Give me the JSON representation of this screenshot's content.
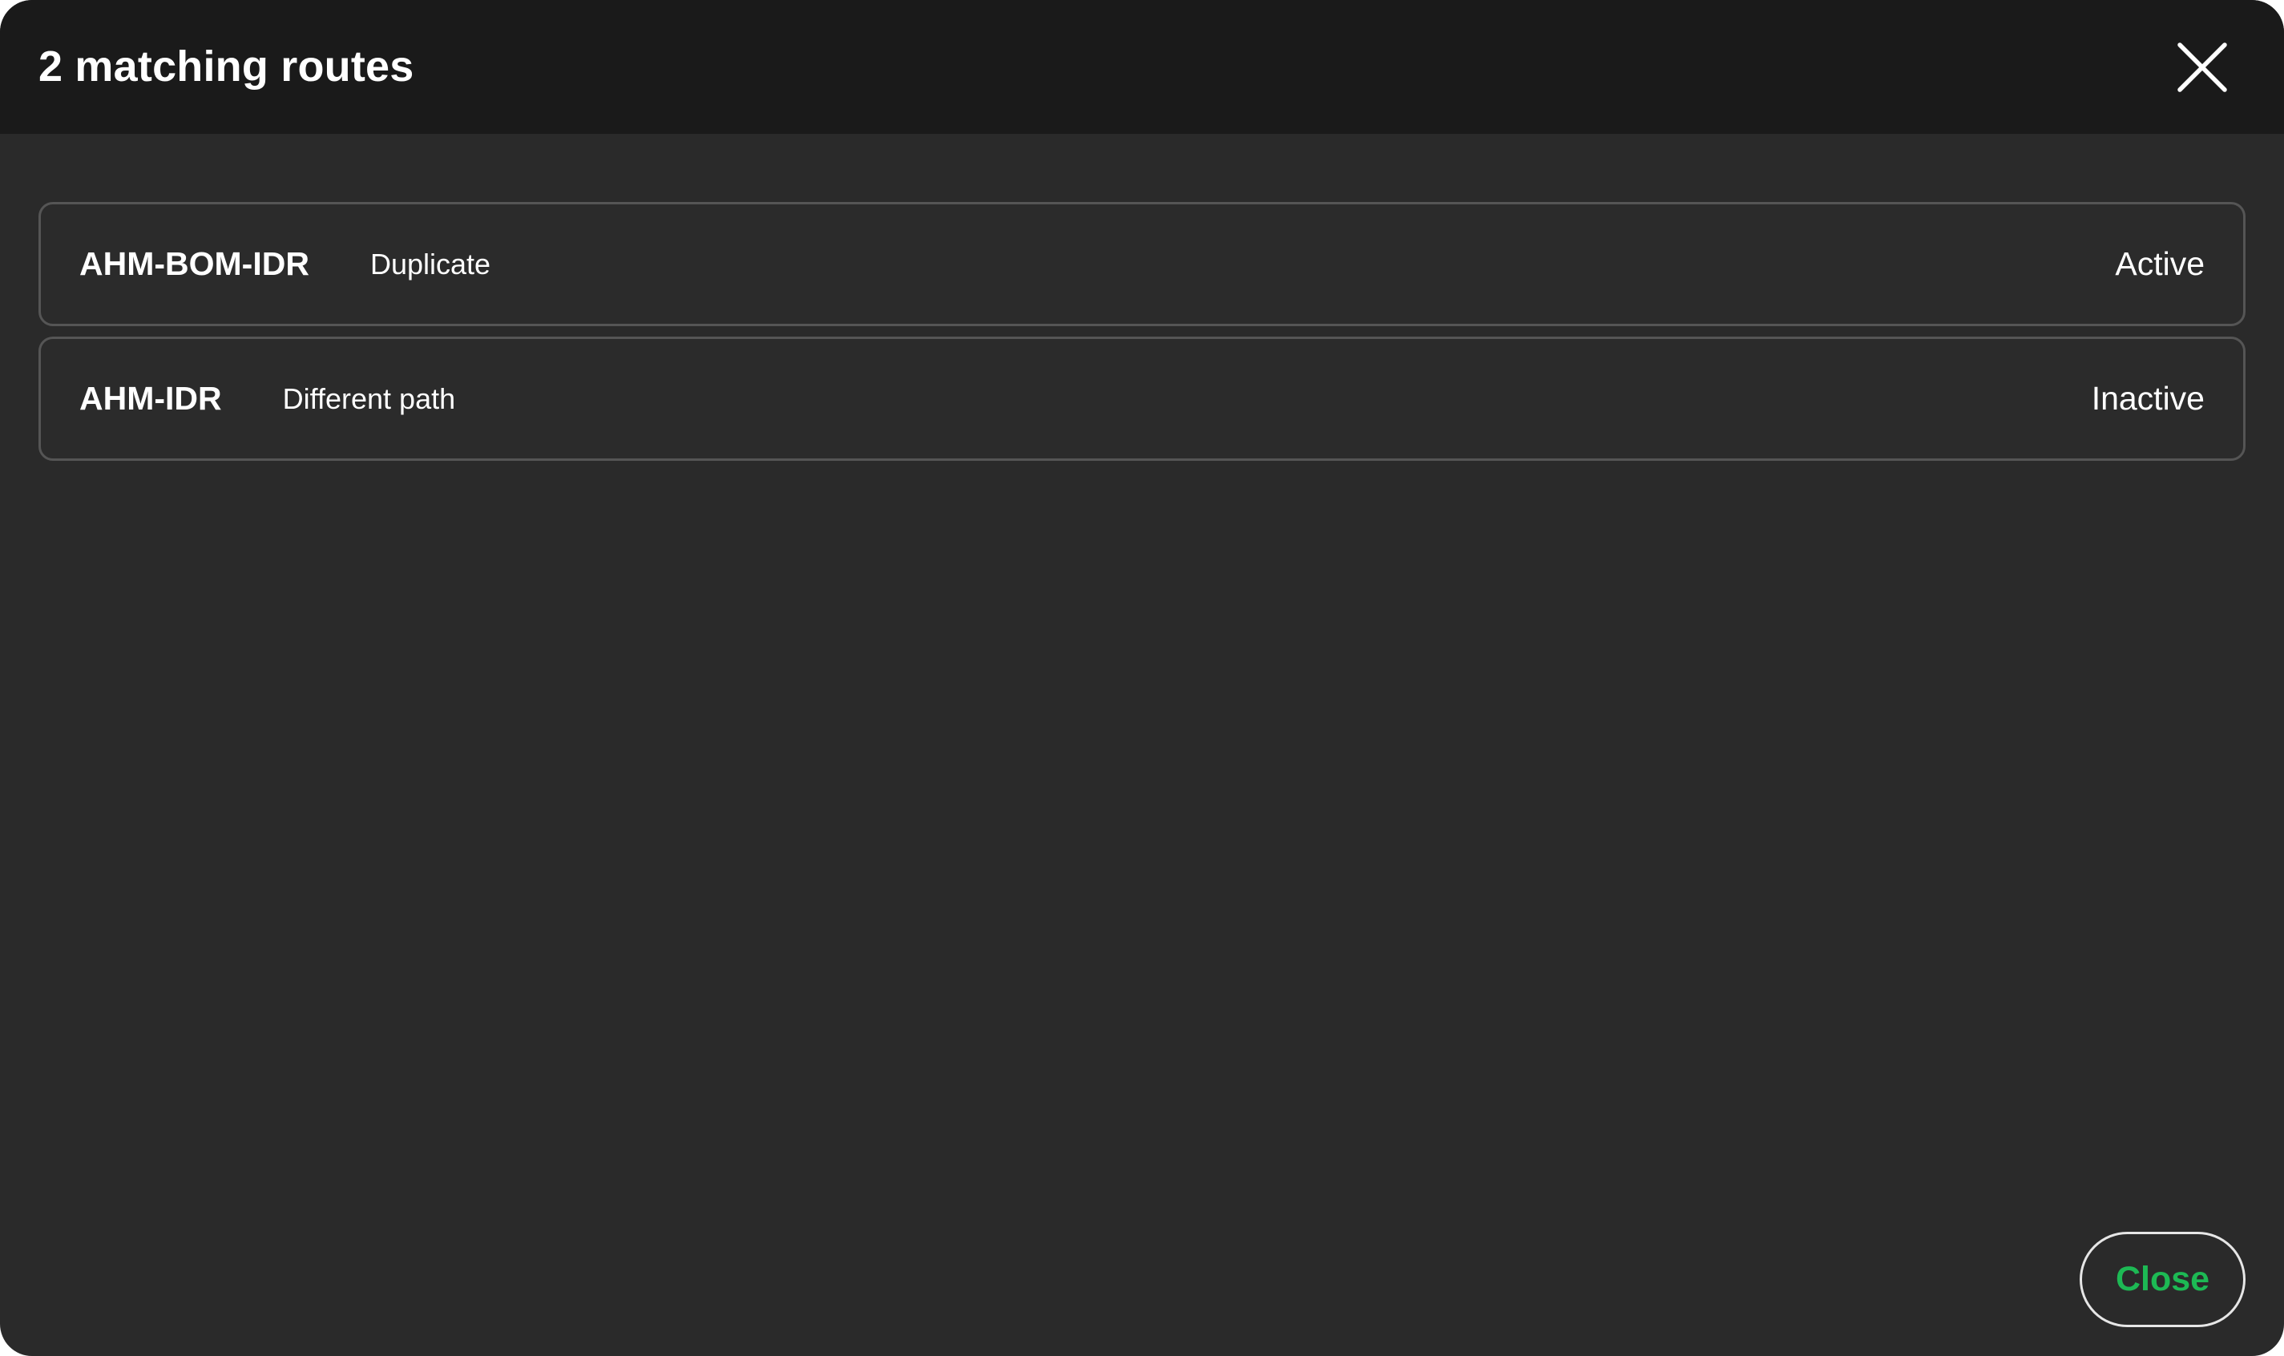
{
  "dialog": {
    "title": "2 matching routes",
    "close_icon": "close-icon"
  },
  "routes": [
    {
      "code": "AHM-BOM-IDR",
      "description": "Duplicate",
      "status": "Active"
    },
    {
      "code": "AHM-IDR",
      "description": "Different path",
      "status": "Inactive"
    }
  ],
  "footer": {
    "close_label": "Close"
  },
  "colors": {
    "dialog_background": "#2a2a2a",
    "header_background": "#1a1a1a",
    "row_border": "#555555",
    "text": "#ffffff",
    "accent": "#1db954"
  }
}
